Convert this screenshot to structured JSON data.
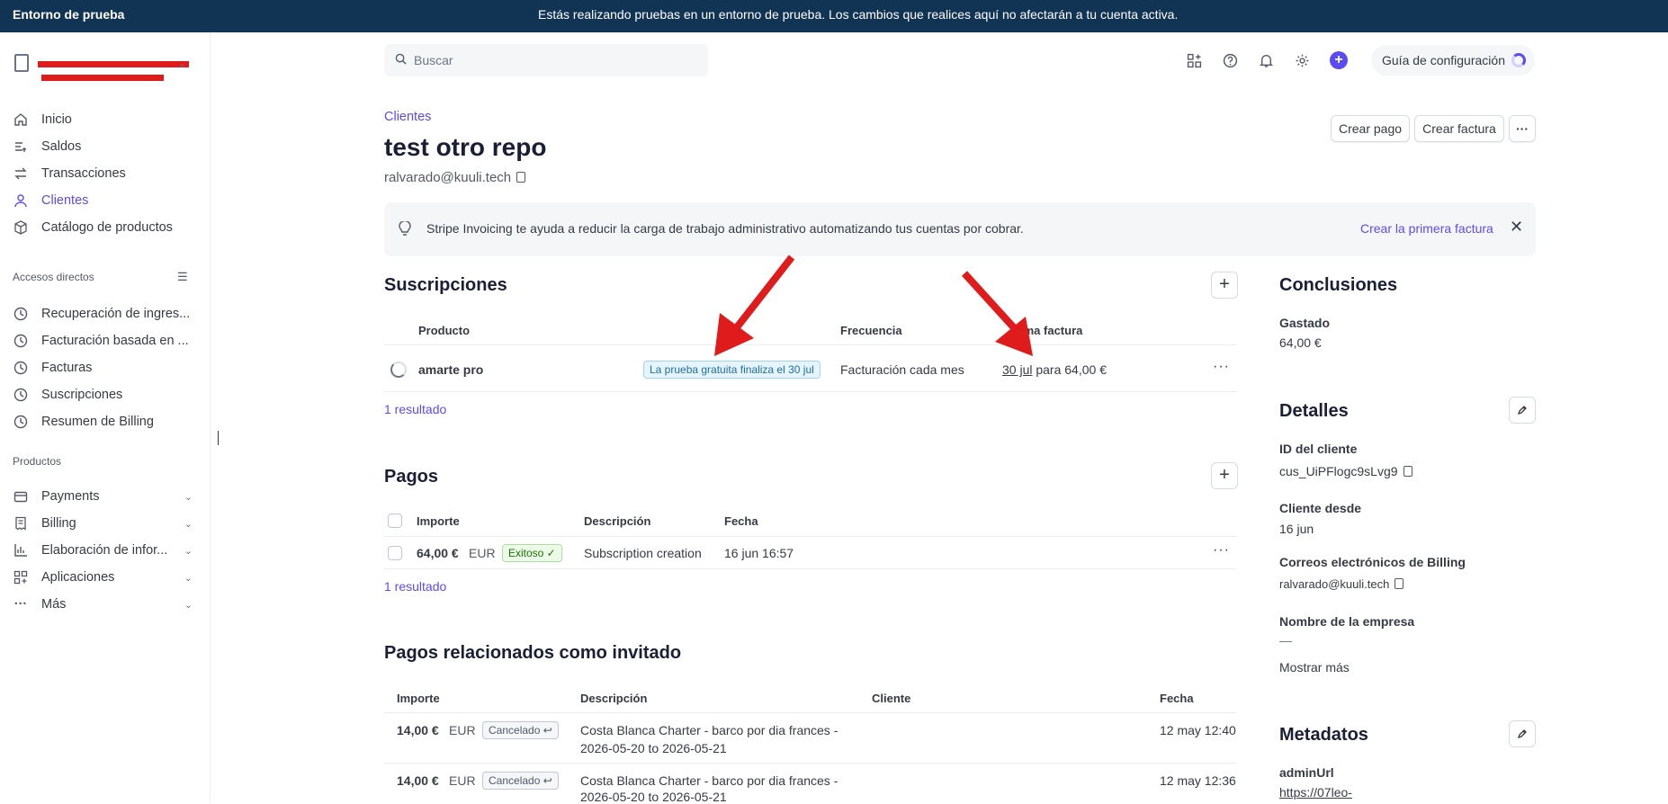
{
  "banner": {
    "env_label": "Entorno de prueba",
    "message": "Estás realizando pruebas en un entorno de prueba. Los cambios que realices aquí no afectarán a tu cuenta activa."
  },
  "sidebar": {
    "main_items": [
      {
        "label": "Inicio",
        "icon": "home-icon"
      },
      {
        "label": "Saldos",
        "icon": "balances-icon"
      },
      {
        "label": "Transacciones",
        "icon": "transactions-icon"
      },
      {
        "label": "Clientes",
        "icon": "customers-icon",
        "active": true
      },
      {
        "label": "Catálogo de productos",
        "icon": "product-catalog-icon"
      }
    ],
    "shortcuts_label": "Accesos directos",
    "shortcuts": [
      {
        "label": "Recuperación de ingres..."
      },
      {
        "label": "Facturación basada en ..."
      },
      {
        "label": "Facturas"
      },
      {
        "label": "Suscripciones"
      },
      {
        "label": "Resumen de Billing"
      }
    ],
    "products_label": "Productos",
    "products": [
      {
        "label": "Payments",
        "icon": "payments-icon"
      },
      {
        "label": "Billing",
        "icon": "billing-icon"
      },
      {
        "label": "Elaboración de infor...",
        "icon": "reporting-icon"
      },
      {
        "label": "Aplicaciones",
        "icon": "apps-icon"
      },
      {
        "label": "Más",
        "icon": "more-icon"
      }
    ]
  },
  "topbar": {
    "search_placeholder": "Buscar",
    "guide_label": "Guía de configuración"
  },
  "header": {
    "breadcrumb": "Clientes",
    "title": "test otro repo",
    "email": "ralvarado@kuuli.tech",
    "create_payment": "Crear pago",
    "create_invoice": "Crear factura"
  },
  "info_banner": {
    "text": "Stripe Invoicing te ayuda a reducir la carga de trabajo administrativo automatizando tus cuentas por cobrar.",
    "link": "Crear la primera factura"
  },
  "subscriptions": {
    "title": "Suscripciones",
    "headers": {
      "product": "Producto",
      "frequency": "Frecuencia",
      "next_invoice": "ima factura"
    },
    "row": {
      "product": "amarte pro",
      "badge": "La prueba gratuita finaliza el 30 jul",
      "frequency": "Facturación cada mes",
      "next_date": "30 jul",
      "next_amount": "para 64,00 €"
    },
    "results": "1 resultado"
  },
  "payments": {
    "title": "Pagos",
    "headers": {
      "amount": "Importe",
      "description": "Descripción",
      "date": "Fecha"
    },
    "row": {
      "amount": "64,00 €",
      "currency": "EUR",
      "status": "Exitoso ✓",
      "description": "Subscription creation",
      "date": "16 jun 16:57"
    },
    "results": "1 resultado"
  },
  "guest_payments": {
    "title": "Pagos relacionados como invitado",
    "headers": {
      "amount": "Importe",
      "description": "Descripción",
      "customer": "Cliente",
      "date": "Fecha"
    },
    "rows": [
      {
        "amount": "14,00 €",
        "currency": "EUR",
        "status": "Cancelado ↩",
        "desc1": "Costa Blanca Charter - barco por dia frances -",
        "desc2": "2026-05-20 to 2026-05-21",
        "date": "12 may 12:40"
      },
      {
        "amount": "14,00 €",
        "currency": "EUR",
        "status": "Cancelado ↩",
        "desc1": "Costa Blanca Charter - barco por dia frances -",
        "desc2": "2026-05-20 to 2026-05-21",
        "date": "12 may 12:36"
      }
    ]
  },
  "right": {
    "conclusions_title": "Conclusiones",
    "spent_label": "Gastado",
    "spent_value": "64,00 €",
    "details_title": "Detalles",
    "customer_id_label": "ID del cliente",
    "customer_id": "cus_UiPFlogc9sLvg9",
    "since_label": "Cliente desde",
    "since_value": "16 jun",
    "billing_emails_label": "Correos electrónicos de Billing",
    "billing_email": "ralvarado@kuuli.tech",
    "company_label": "Nombre de la empresa",
    "company_value": "—",
    "show_more": "Mostrar más",
    "metadata_title": "Metadatos",
    "metadata_key": "adminUrl",
    "metadata_value": "https://07leo-"
  },
  "colors": {
    "accent": "#5b4bf5",
    "banner": "#113354",
    "arrow": "#e01b1b"
  }
}
